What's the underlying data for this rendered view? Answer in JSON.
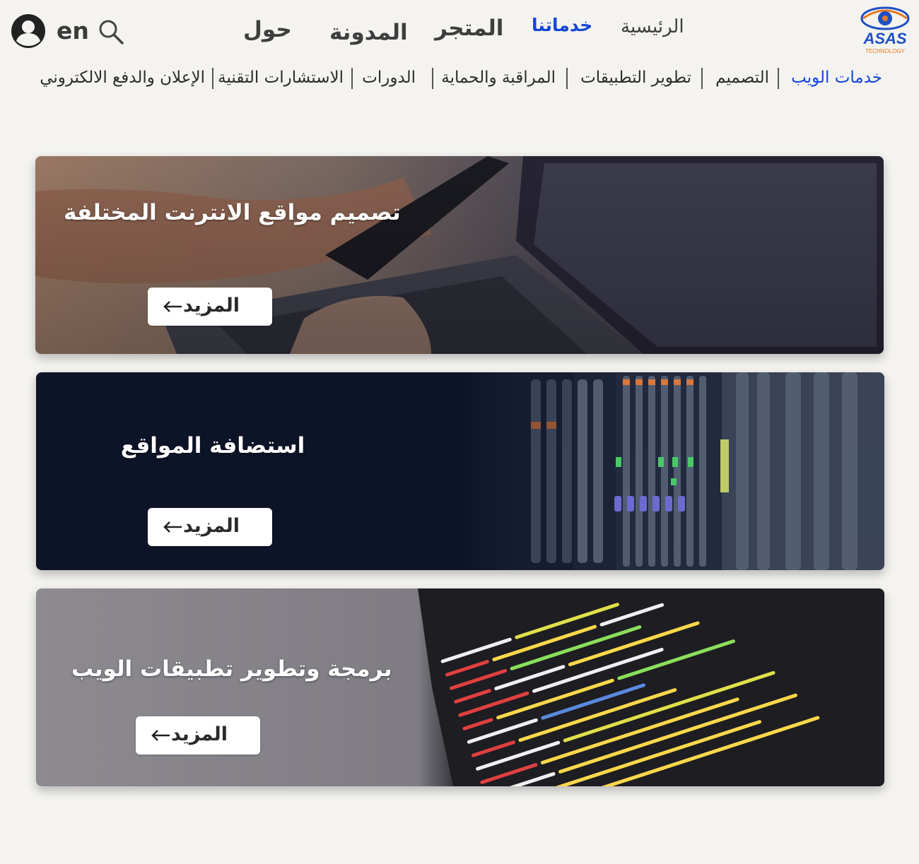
{
  "header": {
    "lang": "en",
    "nav": {
      "home": "الرئيسية",
      "services": "خدماتنا",
      "store": "المتجر",
      "blog": "المدونة",
      "about": "حول"
    },
    "logo": {
      "name": "ASAS",
      "tagline": "TECHNOLOGY"
    }
  },
  "subnav": {
    "items": [
      "خدمات الويب",
      "التصميم",
      "تطوير التطبيقات",
      "المراقبة والحماية",
      "الدورات",
      "الاستشارات التقنية",
      "الإعلان والدفع الالكتروني"
    ]
  },
  "cards": [
    {
      "title": "تصميم مواقع الانترنت المختلفة",
      "button": "المزيد"
    },
    {
      "title": "استضافة المواقع",
      "button": "المزيد"
    },
    {
      "title": "برمجة وتطوير تطبيقات الويب",
      "button": "المزيد"
    }
  ],
  "colors": {
    "active": "#1446d6",
    "background": "#f4f3f0",
    "logo_blue": "#1f4fc4",
    "logo_orange": "#e7781e"
  },
  "icons": [
    "user-account-icon",
    "search-icon",
    "arrow-left-icon"
  ]
}
